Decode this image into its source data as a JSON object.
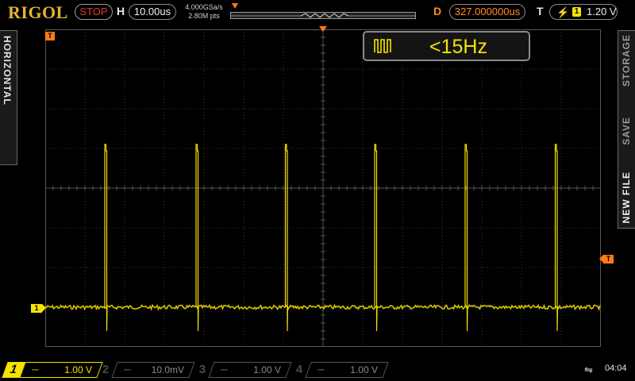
{
  "header": {
    "brand": "RIGOL",
    "run_state": "STOP",
    "h_label": "H",
    "timebase": "10.00us",
    "sample_rate": "4.000GSa/s",
    "memory_depth": "2.80M pts",
    "d_label": "D",
    "delay": "327.000000us",
    "t_label": "T",
    "trigger_source": "1",
    "trigger_level": "1.20 V"
  },
  "left_tab": {
    "label": "HORIZONTAL"
  },
  "right_tab": {
    "items": [
      {
        "label": "STORAGE",
        "active": false
      },
      {
        "label": "SAVE",
        "active": false
      },
      {
        "label": "NEW FILE",
        "active": true
      }
    ]
  },
  "counter": {
    "value": "<15Hz"
  },
  "markers": {
    "ch1": "1",
    "trigger_pos": "T",
    "trigger_level": "T"
  },
  "channels": [
    {
      "num": "1",
      "coupling": "⎓",
      "scale": "1.00 V",
      "active": true
    },
    {
      "num": "2",
      "coupling": "⎓",
      "scale": "10.0mV",
      "active": false
    },
    {
      "num": "3",
      "coupling": "⎓",
      "scale": "1.00 V",
      "active": false
    },
    {
      "num": "4",
      "coupling": "⎓",
      "scale": "1.00 V",
      "active": false
    }
  ],
  "status": {
    "usb_icon": "usb-icon",
    "time": "04:04"
  },
  "colors": {
    "ch1": "#f7e300",
    "trigger": "#ff7a1a",
    "stop": "#e23b2c"
  },
  "waveform": {
    "baseline_div": -3.0,
    "pulse_high_div": 1.1,
    "pulse_low_div": -3.6,
    "pulse_times_div": [
      1.5,
      3.8,
      6.05,
      8.3,
      10.58,
      12.85
    ]
  }
}
